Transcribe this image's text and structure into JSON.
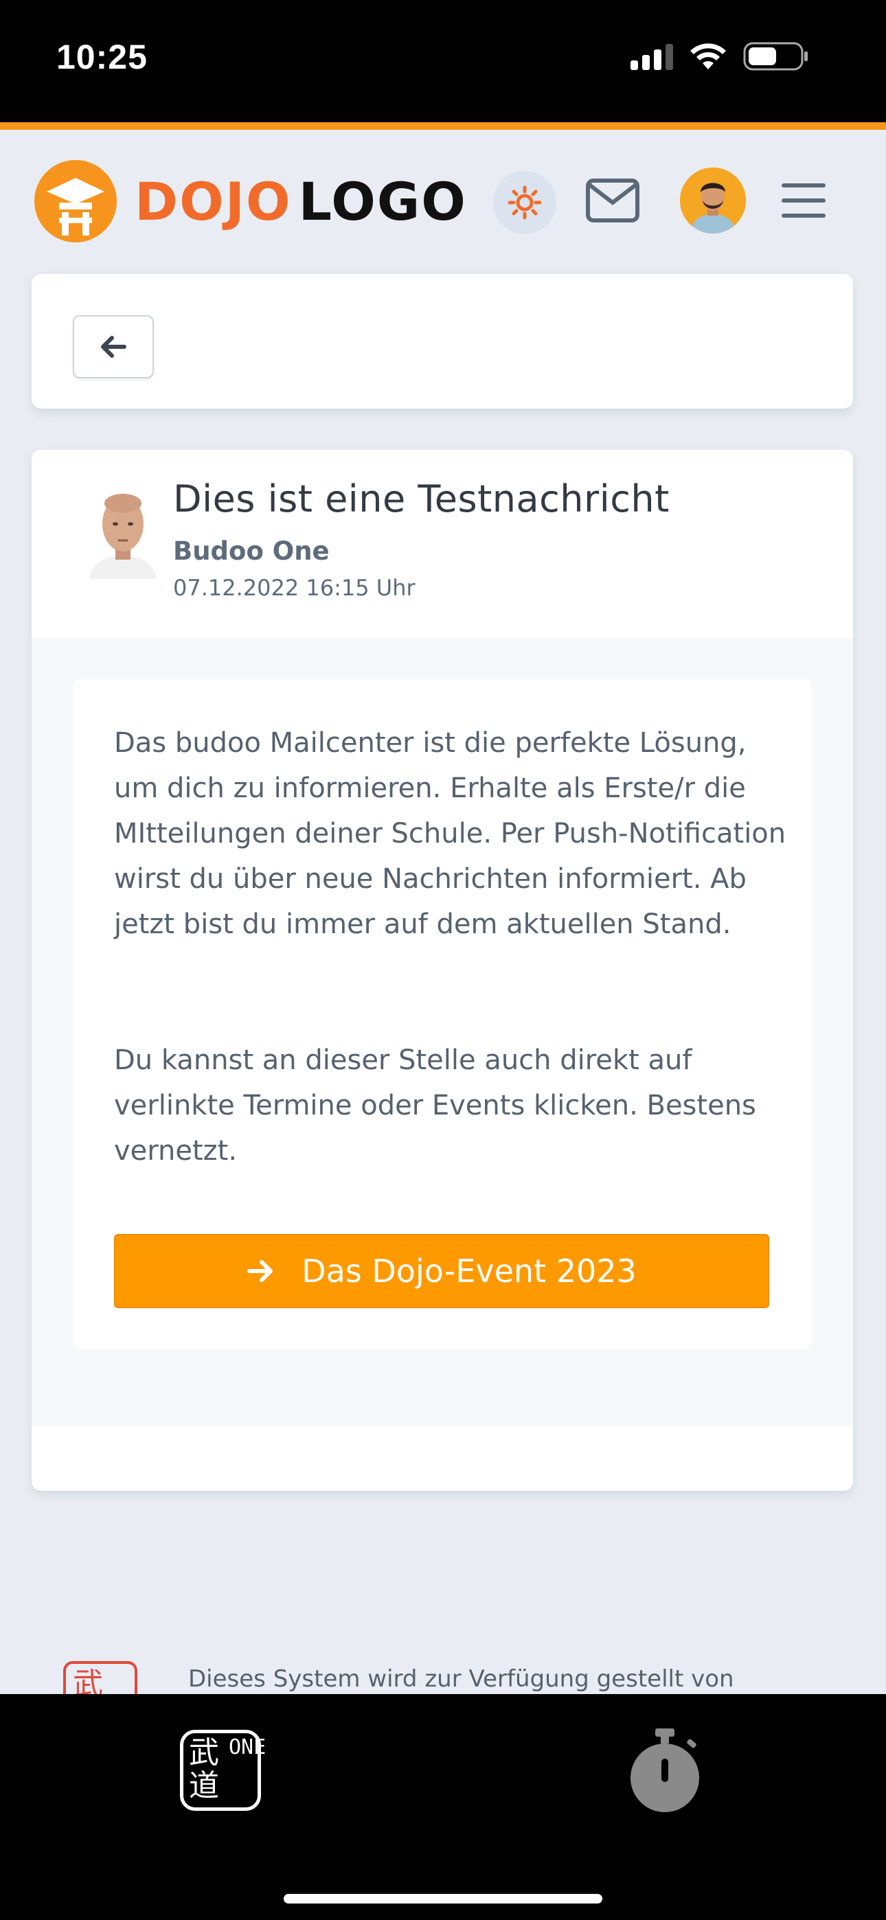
{
  "status_bar": {
    "time": "10:25"
  },
  "header": {
    "logo_part1": "DOJO",
    "logo_part2": "LOGO",
    "colors": {
      "accent": "#f7941d",
      "logo_orange": "#f26b2a"
    }
  },
  "message": {
    "title": "Dies ist eine Testnachricht",
    "sender": "Budoo One",
    "date": "07.12.2022 16:15 Uhr",
    "paragraph1": "Das budoo Mailcenter ist die perfekte Lösung, um dich zu informieren. Erhalte als Erste/r die MItteilungen deiner Schule. Per Push-Notification wirst du über neue Nachrichten informiert. Ab jetzt bist du immer auf dem aktuellen Stand.",
    "paragraph2": "Du kannst an dieser Stelle auch direkt auf verlinkte Termine oder Events klicken. Bestens vernetzt.",
    "event_button_label": "Das Dojo-Event 2023",
    "colors": {
      "button": "#ff9900"
    }
  },
  "footer": {
    "provided_by_text": "Dieses System wird zur Verfügung gestellt von"
  },
  "tab_bar": {
    "home_kanji_1": "武",
    "home_kanji_2": "道",
    "home_letters": "ONE"
  }
}
